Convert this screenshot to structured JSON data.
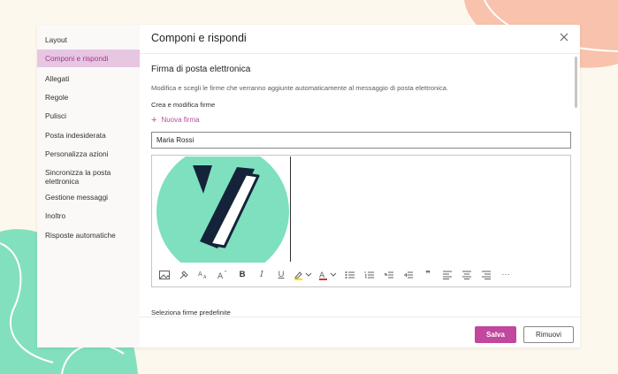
{
  "dialog": {
    "title": "Componi e rispondi",
    "close_icon": "close-icon"
  },
  "sidebar": {
    "items": [
      {
        "label": "Layout",
        "active": false
      },
      {
        "label": "Componi e rispondi",
        "active": true
      },
      {
        "label": "Allegati",
        "active": false
      },
      {
        "label": "Regole",
        "active": false
      },
      {
        "label": "Pulisci",
        "active": false
      },
      {
        "label": "Posta indesiderata",
        "active": false
      },
      {
        "label": "Personalizza azioni",
        "active": false
      },
      {
        "label": "Sincronizza la posta elettronica",
        "active": false
      },
      {
        "label": "Gestione messaggi",
        "active": false
      },
      {
        "label": "Inoltro",
        "active": false
      },
      {
        "label": "Risposte automatiche",
        "active": false
      }
    ]
  },
  "signature": {
    "section_title": "Firma di posta elettronica",
    "description": "Modifica e scegli le firme che verranno aggiunte automaticamente al messaggio di posta elettronica.",
    "create_edit_label": "Crea e modifica firme",
    "new_signature_label": "Nuova firma",
    "name_value": "Maria Rossi",
    "default_label": "Seleziona firme predefinite"
  },
  "toolbar": {
    "icons": [
      "image-icon",
      "format-painter-icon",
      "font-size-icon",
      "grow-font-icon",
      "bold-icon",
      "italic-icon",
      "underline-icon",
      "highlight-icon",
      "font-color-icon",
      "bullets-icon",
      "numbering-icon",
      "decrease-indent-icon",
      "increase-indent-icon",
      "quote-icon",
      "align-left-icon",
      "align-center-icon",
      "align-right-icon",
      "more-icon"
    ],
    "bold": "B",
    "italic": "I",
    "underline": "U",
    "font_color": "A",
    "quote": "❞",
    "more": "···"
  },
  "buttons": {
    "save": "Salva",
    "remove": "Rimuovi"
  },
  "colors": {
    "accent": "#c2479f",
    "active_nav_bg": "#e7c6e2",
    "logo_circle": "#7ee0bf",
    "logo_dark": "#15233a",
    "highlight": "#ffe000",
    "font_color": "#d13438"
  }
}
